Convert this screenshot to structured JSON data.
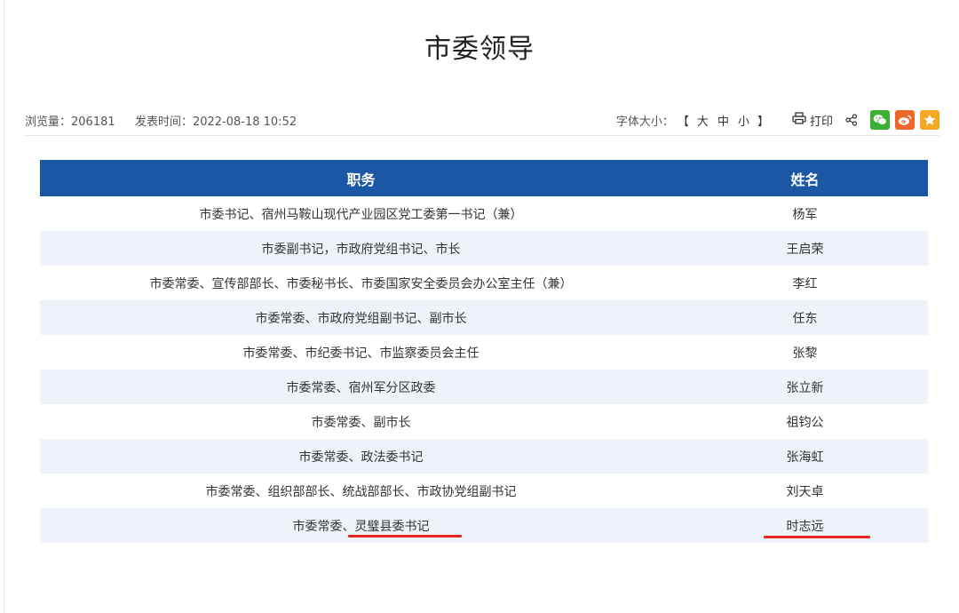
{
  "page": {
    "title": "市委领导"
  },
  "meta": {
    "views_label": "浏览量：",
    "views_value": "206181",
    "publish_label": "发表时间：",
    "publish_time": "2022-08-18 10:52",
    "font_size_label": "字体大小：",
    "bracket_open": "【",
    "bracket_close": "】",
    "font_size_options": [
      "大",
      "中",
      "小"
    ],
    "print_label": "打印"
  },
  "table": {
    "headers": {
      "title": "职务",
      "name": "姓名"
    },
    "rows": [
      {
        "title": "市委书记、宿州马鞍山现代产业园区党工委第一书记（兼）",
        "name": "杨军"
      },
      {
        "title": "市委副书记，市政府党组书记、市长",
        "name": "王启荣"
      },
      {
        "title": "市委常委、宣传部部长、市委秘书长、市委国家安全委员会办公室主任（兼）",
        "name": "李红"
      },
      {
        "title": "市委常委、市政府党组副书记、副市长",
        "name": "任东"
      },
      {
        "title": "市委常委、市纪委书记、市监察委员会主任",
        "name": "张黎"
      },
      {
        "title": "市委常委、宿州军分区政委",
        "name": "张立新"
      },
      {
        "title": "市委常委、副市长",
        "name": "祖钧公"
      },
      {
        "title": "市委常委、政法委书记",
        "name": "张海虹"
      },
      {
        "title": "市委常委、组织部部长、统战部部长、市政协党组副书记",
        "name": "刘天卓"
      },
      {
        "title": "市委常委、灵璧县委书记",
        "name": "时志远"
      }
    ]
  },
  "icons": {
    "print": "printer-icon",
    "share": "share-icon",
    "wechat": "wechat-icon",
    "weibo": "weibo-icon",
    "favorite": "star-icon"
  },
  "colors": {
    "header_bg": "#1b57a5",
    "row_alt_bg": "#eef3fa",
    "highlight_underline": "#e8251d",
    "wechat": "#3cb034",
    "weibo": "#f0672b",
    "favorite": "#f5a623"
  }
}
